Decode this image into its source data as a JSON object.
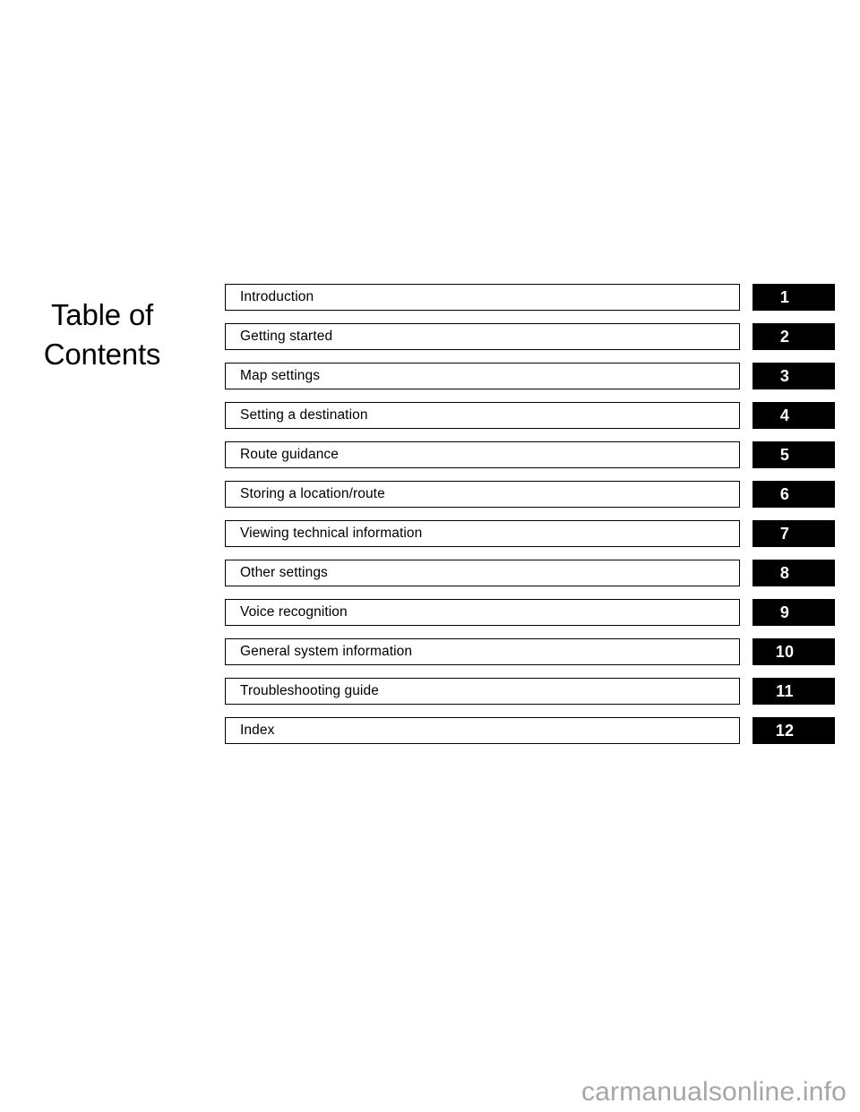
{
  "page": {
    "title_lines": [
      "Table of",
      "Contents"
    ],
    "background_color": "#ffffff",
    "text_color": "#000000",
    "tab_color": "#000000",
    "tab_number_color": "#ffffff"
  },
  "contents": {
    "entries": [
      {
        "number": "1",
        "label": "Introduction"
      },
      {
        "number": "2",
        "label": "Getting started"
      },
      {
        "number": "3",
        "label": "Map settings"
      },
      {
        "number": "4",
        "label": "Setting a destination"
      },
      {
        "number": "5",
        "label": "Route guidance"
      },
      {
        "number": "6",
        "label": "Storing a location/route"
      },
      {
        "number": "7",
        "label": "Viewing technical information"
      },
      {
        "number": "8",
        "label": "Other settings"
      },
      {
        "number": "9",
        "label": "Voice recognition"
      },
      {
        "number": "10",
        "label": "General system information"
      },
      {
        "number": "11",
        "label": "Troubleshooting guide"
      },
      {
        "number": "12",
        "label": "Index"
      }
    ]
  },
  "watermark": {
    "text": "carmanualsonline.info",
    "color": "#a6a6a6"
  }
}
